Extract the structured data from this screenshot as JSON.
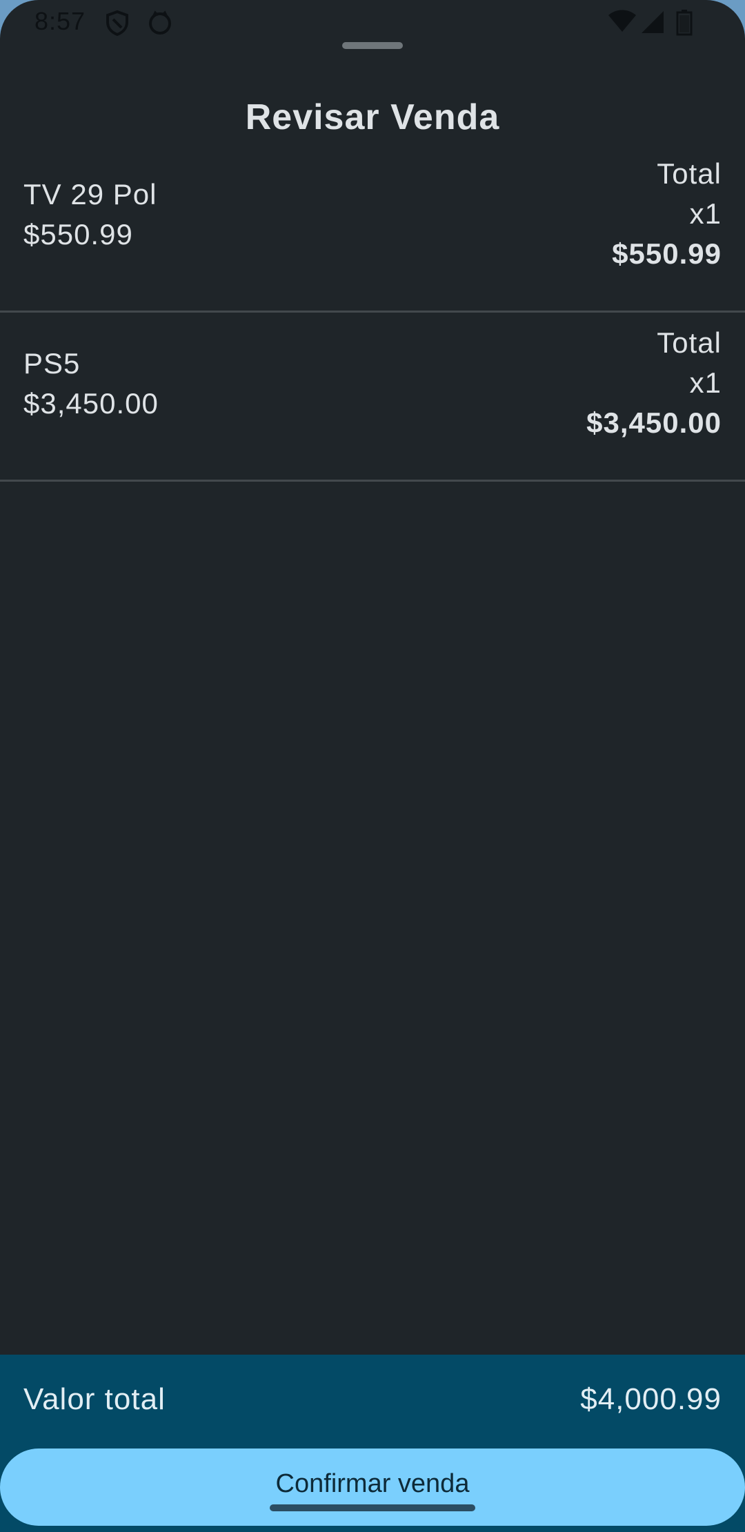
{
  "status_bar": {
    "time": "8:57",
    "icons": [
      "shield-icon",
      "cat-icon",
      "wifi-icon",
      "signal-icon",
      "battery-icon"
    ]
  },
  "sheet": {
    "title": "Revisar Venda"
  },
  "items": [
    {
      "name": "TV 29 Pol",
      "price": "$550.99",
      "total_label": "Total",
      "qty": "x1",
      "total": "$550.99"
    },
    {
      "name": "PS5",
      "price": "$3,450.00",
      "total_label": "Total",
      "qty": "x1",
      "total": "$3,450.00"
    }
  ],
  "footer": {
    "label": "Valor total",
    "value": "$4,000.99",
    "confirm_label": "Confirmar venda"
  },
  "colors": {
    "background": "#1f2529",
    "footer": "#034a66",
    "button": "#7acffd",
    "text": "#dfe3e6",
    "divider": "#43494d"
  }
}
